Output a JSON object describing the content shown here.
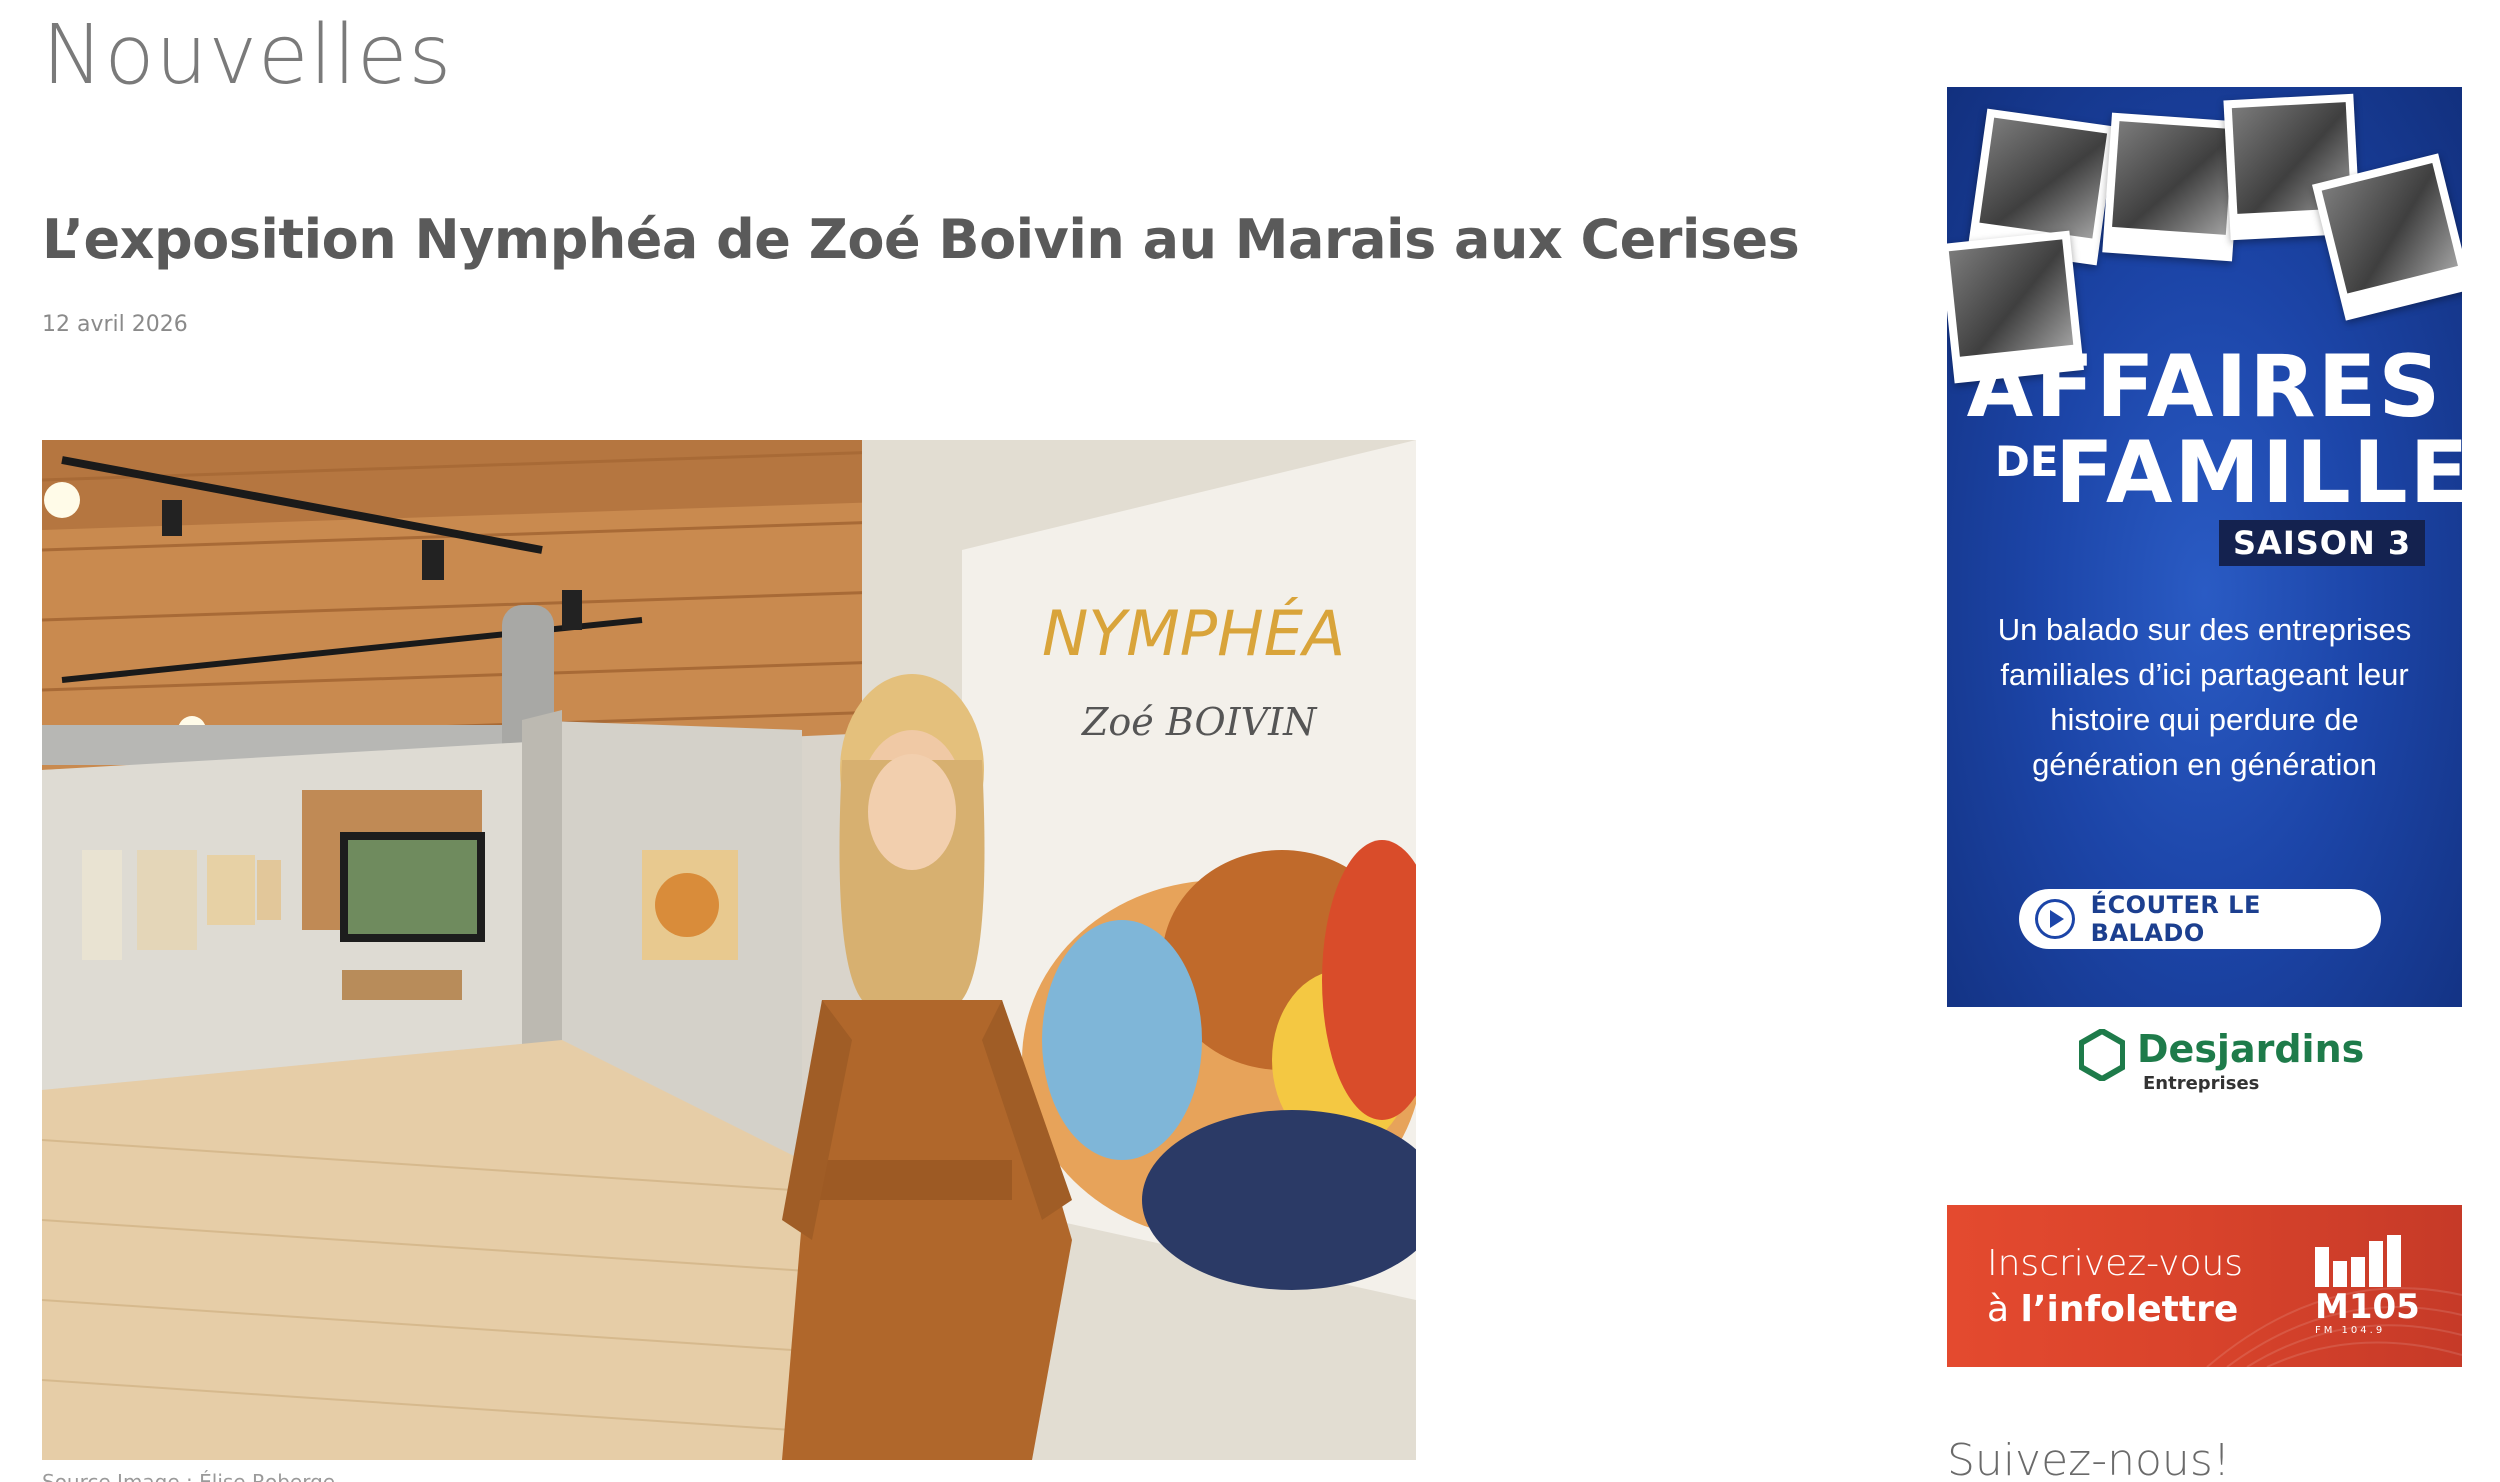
{
  "section": {
    "title": "Nouvelles"
  },
  "article": {
    "title": "L’exposition Nymphéa de Zoé Boivin au Marais aux Cerises",
    "date": "12 avril 2026",
    "image_credit": "Source Image : Élise Roberge",
    "mural_title": "NYMPHÉA",
    "mural_signature": "Zoé BOIVIN"
  },
  "ad": {
    "title_line1": "AFFAIRES",
    "title_de": "DE",
    "title_line2": "FAMILLE",
    "season": "SAISON 3",
    "body": "Un balado sur des entreprises familiales d’ici partageant leur histoire qui perdure de génération en génération",
    "cta_label": "ÉCOUTER LE BALADO",
    "sponsor_name": "Desjardins",
    "sponsor_sub": "Entreprises",
    "colors": {
      "background": "#1c45a8",
      "sponsor_green": "#1e7b4a"
    }
  },
  "newsletter": {
    "line1": "Inscrivez-vous",
    "line2_prefix": "à ",
    "line2_bold": "l’infolettre",
    "brand": "M105",
    "brand_sub": "FM 104.9",
    "color": "#d8432b"
  },
  "sidebar": {
    "follow_title": "Suivez-nous!"
  }
}
